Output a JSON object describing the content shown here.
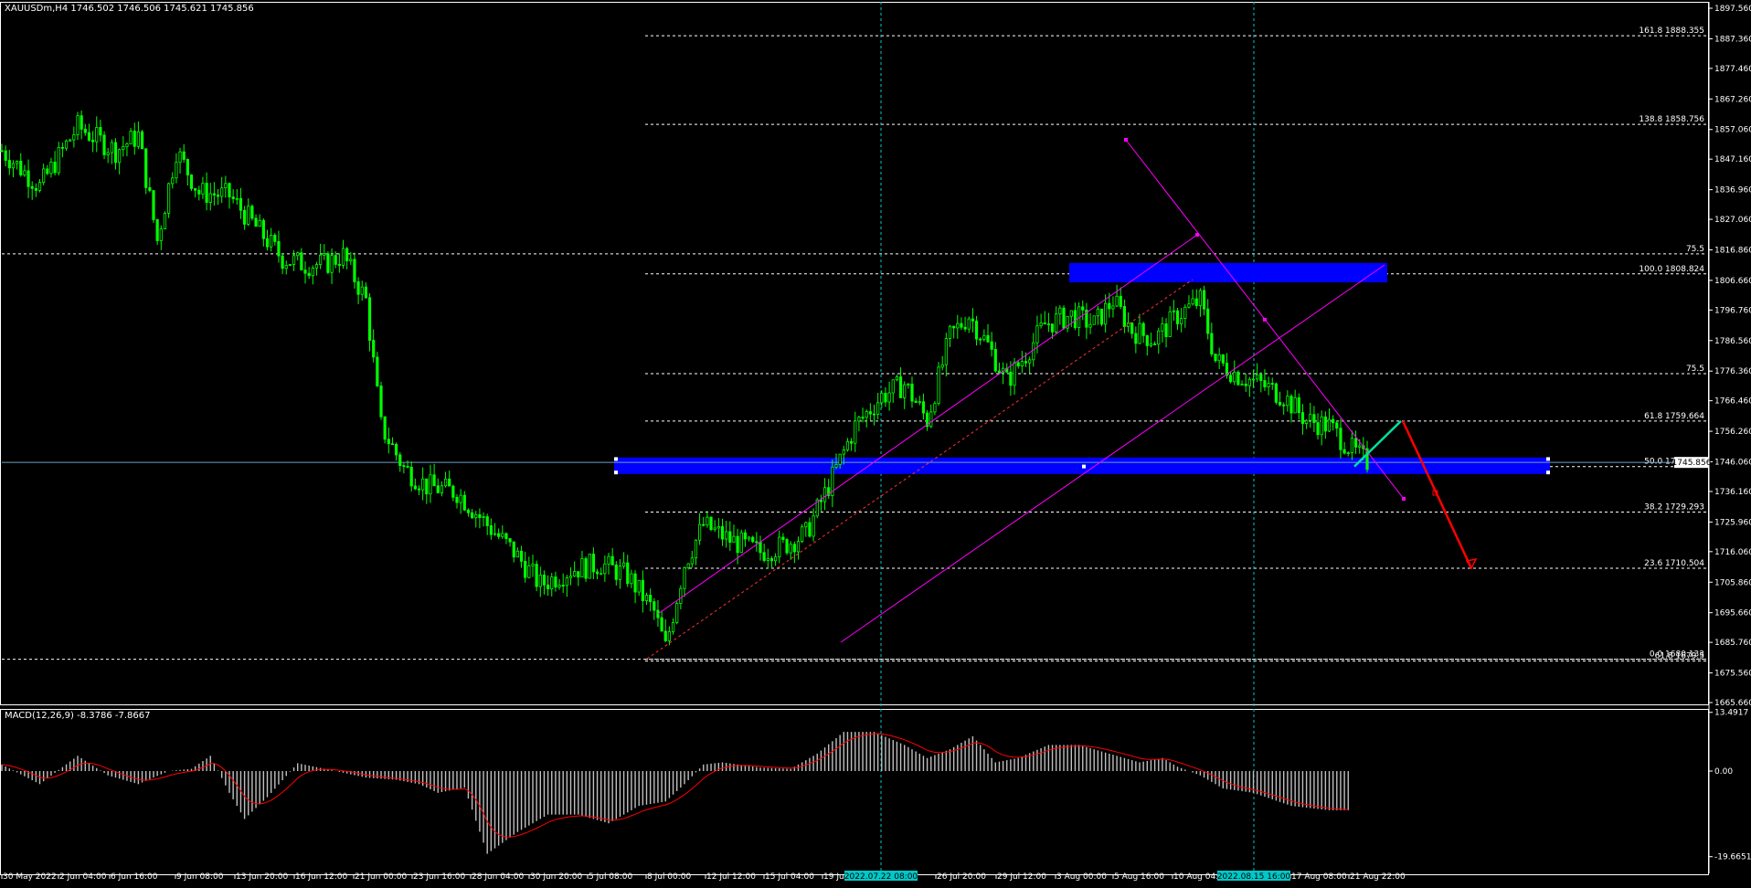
{
  "header": {
    "symbol_text": "XAUUSDm,H4  1746.502 1746.506 1745.621 1745.856",
    "macd_text": "MACD(12,26,9) -8.3786 -7.8667"
  },
  "colors": {
    "background": "#000000",
    "bull": "#00ff00",
    "fib": "#ffffff",
    "channel": "#ff00ff",
    "zone": "#0000ff",
    "bid": "#6fa0c0",
    "period": "#00c8c8",
    "arrow_up": "#00e0a0",
    "arrow_down": "#ff0000",
    "macd_hist": "#c0c0c0",
    "macd_signal": "#ff0000"
  },
  "chart_data": [
    {
      "type": "candlestick",
      "title": "XAUUSDm,H4",
      "timeframe": "H4",
      "ylim": [
        1665.66,
        1897.56
      ],
      "price_ticks": [
        "1897.560",
        "1887.360",
        "1877.460",
        "1867.260",
        "1857.060",
        "1847.160",
        "1836.960",
        "1827.060",
        "1816.860",
        "1806.660",
        "1796.760",
        "1786.560",
        "1776.360",
        "1766.460",
        "1756.260",
        "1746.060",
        "1736.160",
        "1725.960",
        "1716.060",
        "1705.860",
        "1695.660",
        "1685.760",
        "1675.560",
        "1665.660"
      ],
      "time_labels": [
        "30 May 2022",
        "2 Jun 04:00",
        "6 Jun 16:00",
        "9 Jun 08:00",
        "13 Jun 20:00",
        "16 Jun 12:00",
        "21 Jun 00:00",
        "23 Jun 16:00",
        "28 Jun 04:00",
        "30 Jun 20:00",
        "5 Jul 08:00",
        "8 Jul 00:00",
        "12 Jul 12:00",
        "15 Jul 04:00",
        "19 Jul",
        "26 Jul 20:00",
        "29 Jul 12:00",
        "3 Aug 00:00",
        "5 Aug 16:00",
        "10 Aug 04:00",
        "17 Aug 08:00",
        "21 Aug 22:00"
      ],
      "price_path": [
        [
          0,
          1850
        ],
        [
          10,
          1838
        ],
        [
          20,
          1858
        ],
        [
          30,
          1850
        ],
        [
          36,
          1855
        ],
        [
          41,
          1820
        ],
        [
          46,
          1850
        ],
        [
          52,
          1836
        ],
        [
          60,
          1835
        ],
        [
          68,
          1823
        ],
        [
          74,
          1814
        ],
        [
          80,
          1812
        ],
        [
          85,
          1812
        ],
        [
          90,
          1815
        ],
        [
          96,
          1800
        ],
        [
          100,
          1758
        ],
        [
          106,
          1744
        ],
        [
          112,
          1738
        ],
        [
          120,
          1736
        ],
        [
          128,
          1725
        ],
        [
          135,
          1716
        ],
        [
          142,
          1705
        ],
        [
          150,
          1710
        ],
        [
          158,
          1712
        ],
        [
          165,
          1708
        ],
        [
          172,
          1696
        ],
        [
          175,
          1684
        ],
        [
          180,
          1712
        ],
        [
          185,
          1725
        ],
        [
          192,
          1720
        ],
        [
          200,
          1716
        ],
        [
          206,
          1718
        ],
        [
          212,
          1722
        ],
        [
          218,
          1738
        ],
        [
          225,
          1758
        ],
        [
          232,
          1768
        ],
        [
          238,
          1772
        ],
        [
          244,
          1760
        ],
        [
          250,
          1788
        ],
        [
          255,
          1795
        ],
        [
          260,
          1785
        ],
        [
          265,
          1773
        ],
        [
          270,
          1782
        ],
        [
          275,
          1792
        ],
        [
          282,
          1795
        ],
        [
          288,
          1792
        ],
        [
          293,
          1800
        ],
        [
          298,
          1790
        ],
        [
          304,
          1787
        ],
        [
          310,
          1795
        ],
        [
          316,
          1800
        ],
        [
          320,
          1780
        ],
        [
          326,
          1775
        ],
        [
          332,
          1772
        ],
        [
          338,
          1768
        ],
        [
          344,
          1760
        ],
        [
          350,
          1758
        ],
        [
          356,
          1750
        ],
        [
          360,
          1746
        ]
      ],
      "current_price": "1745.856",
      "fibonacci": [
        {
          "label": "161.8",
          "price": 1888.355,
          "text": "161.8 1888.355"
        },
        {
          "label": "138.8",
          "price": 1858.756,
          "text": "138.8 1858.756"
        },
        {
          "label": "100.0",
          "price": 1808.824,
          "text": "100.0 1808.824"
        },
        {
          "label": "61.8",
          "price": 1759.664,
          "text": "61.8 1759.664"
        },
        {
          "label": "50.0",
          "price": 1744.478,
          "text": "50.0 1744.478"
        },
        {
          "label": "38.2",
          "price": 1729.293,
          "text": "38.2 1729.293"
        },
        {
          "label": "23.6",
          "price": 1710.504,
          "text": "23.6 1710.504"
        },
        {
          "label": "0.0",
          "price": 1680.133,
          "text": "0.0 1680.133"
        }
      ],
      "extra_levels": [
        {
          "label": "75.5",
          "price": 1815.5
        },
        {
          "label": "75.5",
          "price": 1775.5
        },
        {
          "label": "61.8",
          "price": 1679.5,
          "text": "61.8 1679.5"
        }
      ],
      "period_markers": [
        "2022.07.22 08:00",
        "2022.08.15 16:00"
      ],
      "annotations": {
        "arrow_up": {
          "from_price": 1744.5,
          "to_price": 1759.7
        },
        "arrow_down": {
          "from_price": 1759.7,
          "to_price": 1710.5
        }
      }
    },
    {
      "type": "macd",
      "title": "MACD(12,26,9)",
      "params": [
        12,
        26,
        9
      ],
      "main_value": -8.3786,
      "signal_value": -7.8667,
      "ticks": [
        "13.4917",
        "0.00",
        "-19.6651"
      ],
      "ylim": [
        -19.6651,
        13.4917
      ],
      "histogram_path": [
        [
          0,
          1.5
        ],
        [
          10,
          -3
        ],
        [
          20,
          3.5
        ],
        [
          28,
          -1
        ],
        [
          36,
          -3
        ],
        [
          44,
          0
        ],
        [
          50,
          0.5
        ],
        [
          55,
          3.5
        ],
        [
          60,
          -5
        ],
        [
          64,
          -11
        ],
        [
          70,
          -6
        ],
        [
          78,
          1.8
        ],
        [
          88,
          0
        ],
        [
          96,
          -1.5
        ],
        [
          104,
          -2
        ],
        [
          110,
          -3
        ],
        [
          115,
          -5
        ],
        [
          122,
          -3.8
        ],
        [
          128,
          -19
        ],
        [
          136,
          -14
        ],
        [
          144,
          -10
        ],
        [
          152,
          -10
        ],
        [
          160,
          -12
        ],
        [
          168,
          -8
        ],
        [
          175,
          -7
        ],
        [
          180,
          -3
        ],
        [
          185,
          1.5
        ],
        [
          190,
          2
        ],
        [
          200,
          0.8
        ],
        [
          208,
          0.5
        ],
        [
          215,
          4
        ],
        [
          222,
          9
        ],
        [
          230,
          9
        ],
        [
          238,
          6
        ],
        [
          244,
          3
        ],
        [
          250,
          5
        ],
        [
          256,
          8
        ],
        [
          262,
          2
        ],
        [
          268,
          3
        ],
        [
          276,
          6
        ],
        [
          284,
          6
        ],
        [
          292,
          4
        ],
        [
          300,
          2
        ],
        [
          306,
          3
        ],
        [
          310,
          1
        ],
        [
          316,
          -1
        ],
        [
          322,
          -4
        ],
        [
          330,
          -5
        ],
        [
          340,
          -8
        ],
        [
          350,
          -9
        ],
        [
          355,
          -9
        ]
      ]
    }
  ]
}
